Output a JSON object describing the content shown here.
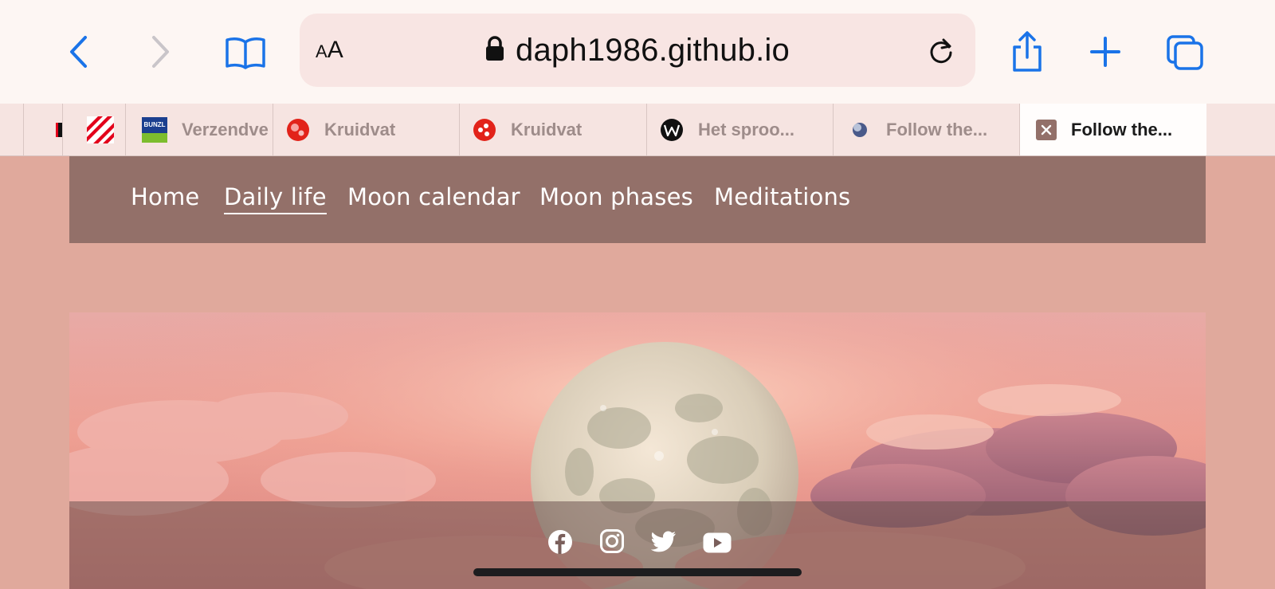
{
  "browser": {
    "url": "daph1986.github.io",
    "text_size_button": {
      "small": "A",
      "large": "A"
    },
    "icons": [
      "back-icon",
      "forward-icon",
      "bookmarks-icon",
      "lock-icon",
      "reload-icon",
      "share-icon",
      "new-tab-icon",
      "tabs-overview-icon"
    ],
    "accent_color": "#1a73e8",
    "tabs": [
      {
        "title": "",
        "favicon": "red-black-favicon"
      },
      {
        "title": "",
        "favicon": "red-stripes-favicon"
      },
      {
        "title": "Verzendve",
        "favicon": "bunzl-favicon"
      },
      {
        "title": "Kruidvat",
        "favicon": "kruidvat-favicon"
      },
      {
        "title": "Kruidvat",
        "favicon": "kruidvat-favicon"
      },
      {
        "title": "Het sproo...",
        "favicon": "w-circle-favicon"
      },
      {
        "title": "Follow the...",
        "favicon": "moon-favicon"
      },
      {
        "title": "Follow the...",
        "favicon": "close-tab-icon",
        "active": true
      }
    ],
    "bunzl_logo_text": "BUNZL"
  },
  "nav": {
    "items": [
      "Home",
      "Daily life",
      "Moon calendar",
      "Moon phases",
      "Meditations"
    ],
    "active": "Daily life",
    "background_color": "#937069"
  },
  "hero": {
    "image": "full-moon-pink-clouds",
    "social_icons": [
      "facebook-icon",
      "instagram-icon",
      "twitter-icon",
      "youtube-icon"
    ]
  },
  "colors": {
    "page_background": "#e0a99c",
    "toolbar_background": "#fdf6f3",
    "address_bar": "#f8e5e3"
  }
}
